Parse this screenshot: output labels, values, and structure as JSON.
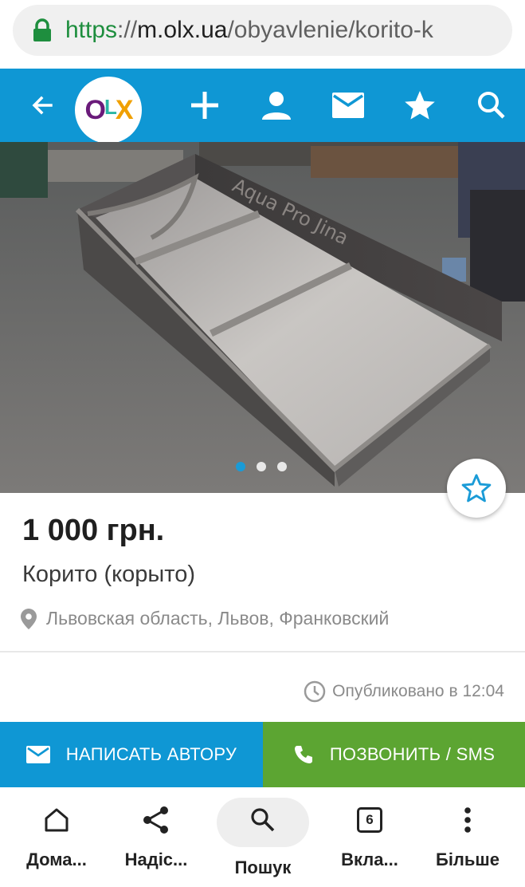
{
  "browser": {
    "url_scheme": "https",
    "url_sep": "://",
    "url_host": "m.olx.ua",
    "url_path": "/obyavlenie/korito-k",
    "lock_icon": "lock-icon"
  },
  "header": {
    "bg_color": "#0f97d4",
    "logo_o": "O",
    "logo_l": "L",
    "logo_x": "X",
    "icons": [
      "back-arrow-icon",
      "plus-icon",
      "user-icon",
      "mail-icon",
      "star-icon",
      "search-icon"
    ]
  },
  "gallery": {
    "photo_text": "Aqua Pro Jina",
    "slide_count": 3,
    "active_slide": 1
  },
  "listing": {
    "price": "1 000 грн.",
    "title": "Корито (корыто)",
    "location": "Львовская область, Львов, Франковский",
    "published": "Опубликовано в 12:04"
  },
  "actions": {
    "write_label": "НАПИСАТЬ АВТОРУ",
    "call_label": "ПОЗВОНИТЬ / SMS",
    "write_color": "#0f97d4",
    "call_color": "#5ca532"
  },
  "bottom_nav": {
    "home": "Дома...",
    "share": "Надіс...",
    "search": "Пошук",
    "tabs": "Вкла...",
    "tabs_count": "6",
    "more": "Більше"
  }
}
